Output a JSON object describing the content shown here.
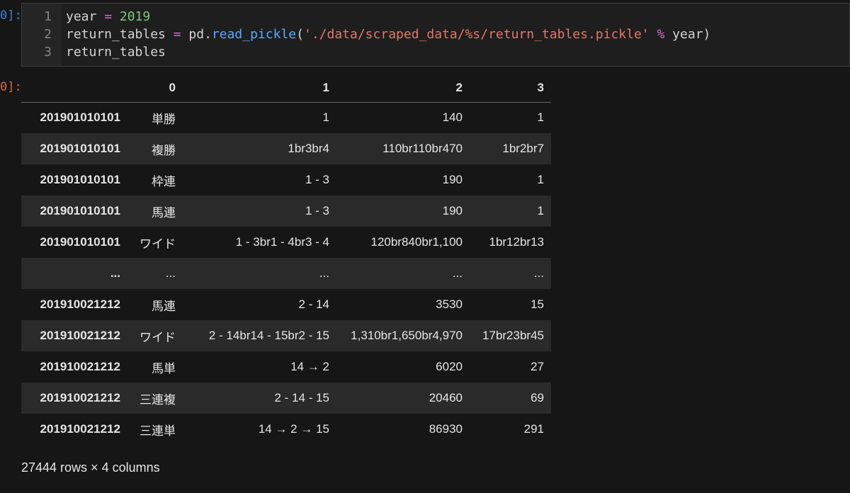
{
  "prompts": {
    "input": "0]:",
    "output": "0]:"
  },
  "code": {
    "line_numbers": [
      "1",
      "2",
      "3"
    ],
    "lines": [
      [
        {
          "text": "year ",
          "cls": "plain"
        },
        {
          "text": "=",
          "cls": "op"
        },
        {
          "text": " 2019",
          "cls": "num"
        }
      ],
      [
        {
          "text": "return_tables ",
          "cls": "plain"
        },
        {
          "text": "=",
          "cls": "op"
        },
        {
          "text": " pd.",
          "cls": "plain"
        },
        {
          "text": "read_pickle",
          "cls": "func"
        },
        {
          "text": "(",
          "cls": "plain"
        },
        {
          "text": "'./data/scraped_data/%s/return_tables.pickle'",
          "cls": "str"
        },
        {
          "text": " ",
          "cls": "plain"
        },
        {
          "text": "%",
          "cls": "op"
        },
        {
          "text": " year)",
          "cls": "plain"
        }
      ],
      [
        {
          "text": "return_tables",
          "cls": "plain"
        }
      ]
    ]
  },
  "table": {
    "columns": [
      "",
      "0",
      "1",
      "2",
      "3"
    ],
    "rows": [
      [
        "201901010101",
        "単勝",
        "1",
        "140",
        "1"
      ],
      [
        "201901010101",
        "複勝",
        "1br3br4",
        "110br110br470",
        "1br2br7"
      ],
      [
        "201901010101",
        "枠連",
        "1 - 3",
        "190",
        "1"
      ],
      [
        "201901010101",
        "馬連",
        "1 - 3",
        "190",
        "1"
      ],
      [
        "201901010101",
        "ワイド",
        "1 - 3br1 - 4br3 - 4",
        "120br840br1,100",
        "1br12br13"
      ],
      [
        "...",
        "...",
        "...",
        "...",
        "..."
      ],
      [
        "201910021212",
        "馬連",
        "2 - 14",
        "3530",
        "15"
      ],
      [
        "201910021212",
        "ワイド",
        "2 - 14br14 - 15br2 - 15",
        "1,310br1,650br4,970",
        "17br23br45"
      ],
      [
        "201910021212",
        "馬単",
        "14 → 2",
        "6020",
        "27"
      ],
      [
        "201910021212",
        "三連複",
        "2 - 14 - 15",
        "20460",
        "69"
      ],
      [
        "201910021212",
        "三連単",
        "14 → 2 → 15",
        "86930",
        "291"
      ]
    ]
  },
  "footer": "27444 rows × 4 columns"
}
